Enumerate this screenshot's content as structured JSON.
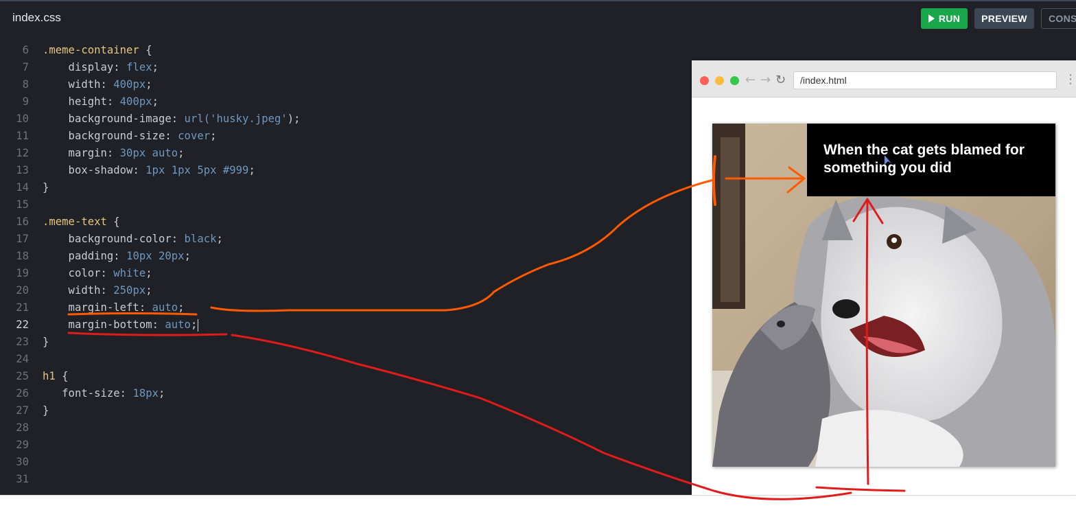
{
  "header": {
    "file_title": "index.css",
    "run_label": "RUN",
    "preview_label": "PREVIEW",
    "console_label": "CONS",
    "run_icon": "play-icon"
  },
  "editor": {
    "lines": [
      {
        "num": "6",
        "tokens": [
          {
            "t": ".meme-container",
            "c": "sel"
          },
          {
            "t": " {",
            "c": "pun"
          }
        ]
      },
      {
        "num": "7",
        "tokens": [
          {
            "t": "    display",
            "c": "prop"
          },
          {
            "t": ": ",
            "c": "pun"
          },
          {
            "t": "flex",
            "c": "val"
          },
          {
            "t": ";",
            "c": "pun"
          }
        ]
      },
      {
        "num": "8",
        "tokens": [
          {
            "t": "    width",
            "c": "prop"
          },
          {
            "t": ": ",
            "c": "pun"
          },
          {
            "t": "400px",
            "c": "val"
          },
          {
            "t": ";",
            "c": "pun"
          }
        ]
      },
      {
        "num": "9",
        "tokens": [
          {
            "t": "    height",
            "c": "prop"
          },
          {
            "t": ": ",
            "c": "pun"
          },
          {
            "t": "400px",
            "c": "val"
          },
          {
            "t": ";",
            "c": "pun"
          }
        ]
      },
      {
        "num": "10",
        "tokens": [
          {
            "t": "    background-image",
            "c": "prop"
          },
          {
            "t": ": ",
            "c": "pun"
          },
          {
            "t": "url(",
            "c": "val"
          },
          {
            "t": "'husky.jpeg'",
            "c": "str"
          },
          {
            "t": ");",
            "c": "pun"
          }
        ]
      },
      {
        "num": "11",
        "tokens": [
          {
            "t": "    background-size",
            "c": "prop"
          },
          {
            "t": ": ",
            "c": "pun"
          },
          {
            "t": "cover",
            "c": "val"
          },
          {
            "t": ";",
            "c": "pun"
          }
        ]
      },
      {
        "num": "12",
        "tokens": [
          {
            "t": "    margin",
            "c": "prop"
          },
          {
            "t": ": ",
            "c": "pun"
          },
          {
            "t": "30px auto",
            "c": "val"
          },
          {
            "t": ";",
            "c": "pun"
          }
        ]
      },
      {
        "num": "13",
        "tokens": [
          {
            "t": "    box-shadow",
            "c": "prop"
          },
          {
            "t": ": ",
            "c": "pun"
          },
          {
            "t": "1px 1px 5px #999",
            "c": "val"
          },
          {
            "t": ";",
            "c": "pun"
          }
        ]
      },
      {
        "num": "14",
        "tokens": [
          {
            "t": "}",
            "c": "pun"
          }
        ]
      },
      {
        "num": "15",
        "tokens": []
      },
      {
        "num": "16",
        "tokens": [
          {
            "t": ".meme-text",
            "c": "sel"
          },
          {
            "t": " {",
            "c": "pun"
          }
        ]
      },
      {
        "num": "17",
        "tokens": [
          {
            "t": "    background-color",
            "c": "prop"
          },
          {
            "t": ": ",
            "c": "pun"
          },
          {
            "t": "black",
            "c": "val"
          },
          {
            "t": ";",
            "c": "pun"
          }
        ]
      },
      {
        "num": "18",
        "tokens": [
          {
            "t": "    padding",
            "c": "prop"
          },
          {
            "t": ": ",
            "c": "pun"
          },
          {
            "t": "10px 20px",
            "c": "val"
          },
          {
            "t": ";",
            "c": "pun"
          }
        ]
      },
      {
        "num": "19",
        "tokens": [
          {
            "t": "    color",
            "c": "prop"
          },
          {
            "t": ": ",
            "c": "pun"
          },
          {
            "t": "white",
            "c": "val"
          },
          {
            "t": ";",
            "c": "pun"
          }
        ]
      },
      {
        "num": "20",
        "tokens": [
          {
            "t": "    width",
            "c": "prop"
          },
          {
            "t": ": ",
            "c": "pun"
          },
          {
            "t": "250px",
            "c": "val"
          },
          {
            "t": ";",
            "c": "pun"
          }
        ]
      },
      {
        "num": "21",
        "tokens": [
          {
            "t": "    margin-left",
            "c": "prop"
          },
          {
            "t": ": ",
            "c": "pun"
          },
          {
            "t": "auto",
            "c": "val"
          },
          {
            "t": ";",
            "c": "pun"
          }
        ]
      },
      {
        "num": "22",
        "tokens": [
          {
            "t": "    margin-bottom",
            "c": "prop"
          },
          {
            "t": ": ",
            "c": "pun"
          },
          {
            "t": "auto",
            "c": "val"
          },
          {
            "t": ";",
            "c": "pun"
          }
        ],
        "caret": true,
        "active": true
      },
      {
        "num": "23",
        "tokens": [
          {
            "t": "}",
            "c": "pun"
          }
        ]
      },
      {
        "num": "24",
        "tokens": []
      },
      {
        "num": "25",
        "tokens": [
          {
            "t": "h1",
            "c": "sel"
          },
          {
            "t": " {",
            "c": "pun"
          }
        ]
      },
      {
        "num": "26",
        "tokens": [
          {
            "t": "   font-size",
            "c": "prop"
          },
          {
            "t": ": ",
            "c": "pun"
          },
          {
            "t": "18px",
            "c": "val"
          },
          {
            "t": ";",
            "c": "pun"
          }
        ]
      },
      {
        "num": "27",
        "tokens": [
          {
            "t": "}",
            "c": "pun"
          }
        ]
      },
      {
        "num": "28",
        "tokens": []
      },
      {
        "num": "29",
        "tokens": []
      },
      {
        "num": "30",
        "tokens": []
      },
      {
        "num": "31",
        "tokens": []
      }
    ]
  },
  "preview": {
    "url": "/index.html",
    "meme_text": "When the cat gets blamed for something you did",
    "back_icon": "back-arrow-icon",
    "forward_icon": "forward-arrow-icon",
    "reload_icon": "reload-icon",
    "menu_icon": "kebab-menu-icon"
  },
  "colors": {
    "editor_bg": "#1f2127",
    "run_green": "#1aa64a",
    "preview_btn": "#3a4654",
    "annotation_orange": "#ff5a00",
    "annotation_red": "#e01b1b"
  }
}
